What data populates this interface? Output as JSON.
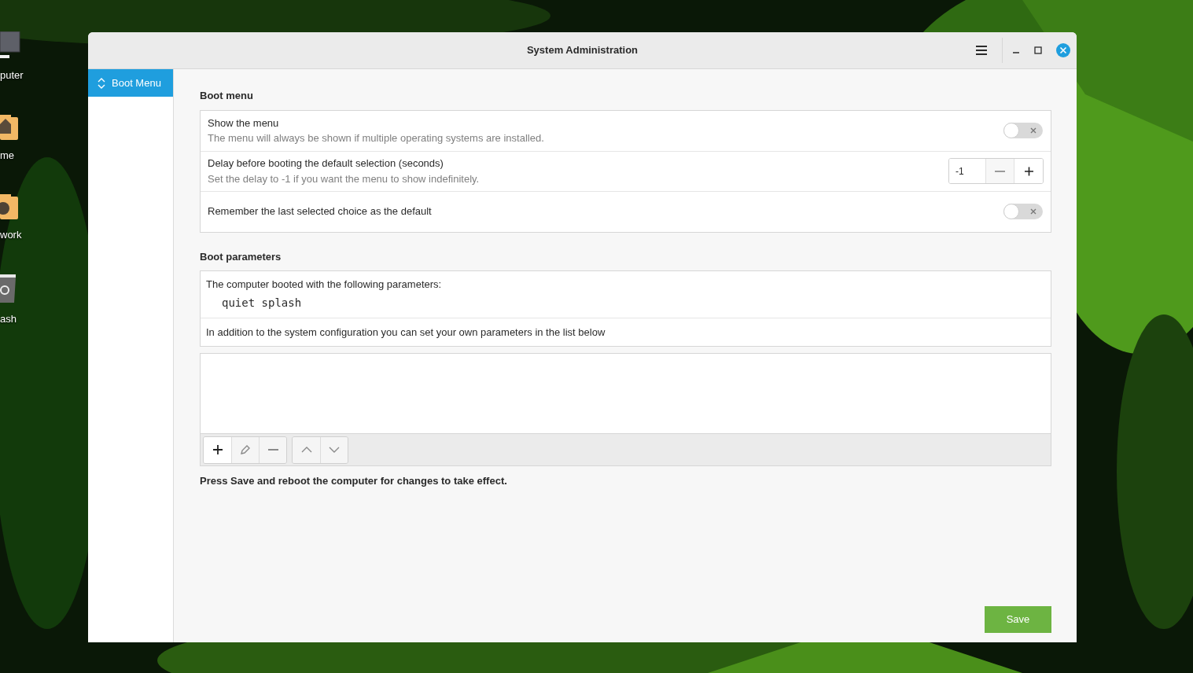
{
  "desktop_icons": [
    {
      "kind": "computer",
      "label": "puter"
    },
    {
      "kind": "home",
      "label": "me"
    },
    {
      "kind": "network",
      "label": "work"
    },
    {
      "kind": "trash",
      "label": "ash"
    }
  ],
  "window": {
    "title": "System Administration"
  },
  "sidebar": {
    "items": [
      {
        "label": "Boot Menu",
        "selected": true
      }
    ]
  },
  "boot_menu": {
    "heading": "Boot menu",
    "rows": [
      {
        "kind": "switch",
        "title": "Show the menu",
        "subtitle": "The menu will always be shown if multiple operating systems are installed.",
        "on": false
      },
      {
        "kind": "spin",
        "title": "Delay before booting the default selection (seconds)",
        "subtitle": "Set the delay to -1 if you want the menu to show indefinitely.",
        "value": "-1",
        "minus_disabled": true,
        "plus_disabled": false
      },
      {
        "kind": "switch",
        "title": "Remember the last selected choice as the default",
        "on": false
      }
    ]
  },
  "boot_parameters": {
    "heading": "Boot parameters",
    "intro": "The computer booted with the following parameters:",
    "parameters": "quiet splash",
    "note": "In addition to the system configuration you can set your own parameters in the list below",
    "toolbar": [
      {
        "kind": "add",
        "disabled": false
      },
      {
        "kind": "edit",
        "disabled": true
      },
      {
        "kind": "remove",
        "disabled": true
      },
      {
        "kind": "up",
        "disabled": true,
        "group_start": true
      },
      {
        "kind": "down",
        "disabled": true
      }
    ]
  },
  "footer_note": "Press Save and reboot the computer for changes to take effect.",
  "save_button": "Save"
}
